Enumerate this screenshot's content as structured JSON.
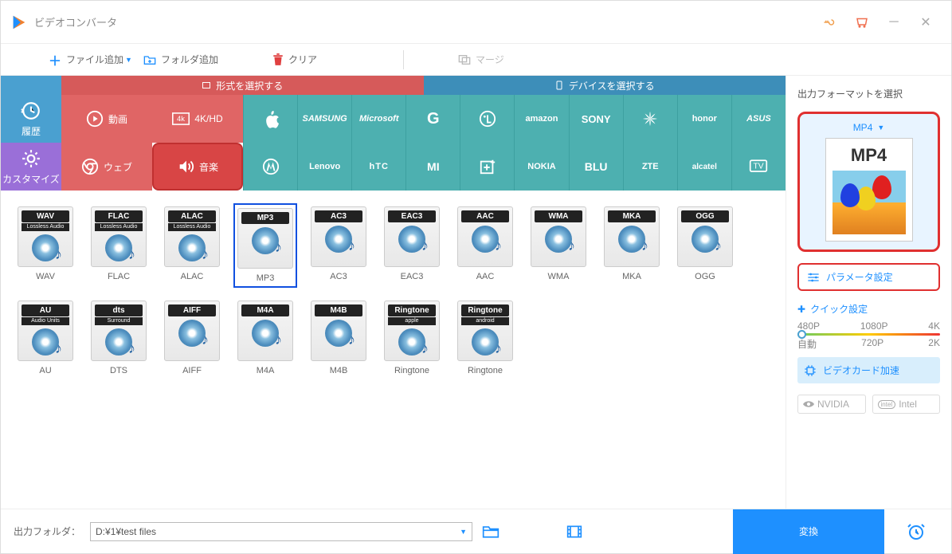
{
  "app": {
    "title": "ビデオコンバータ"
  },
  "toolbar": {
    "addFile": "ファイル追加",
    "addFolder": "フォルダ追加",
    "clear": "クリア",
    "merge": "マージ"
  },
  "tabs": {
    "format": "形式を選択する",
    "device": "デバイスを選択する"
  },
  "side": {
    "history": "履歴",
    "customize": "カスタマイズ"
  },
  "categories": {
    "video": "動画",
    "fourk": "4K/HD",
    "web": "ウェブ",
    "audio": "音楽"
  },
  "brands": [
    "Apple",
    "SAMSUNG",
    "Microsoft",
    "G",
    "LG",
    "amazon",
    "SONY",
    "HUAWEI",
    "honor",
    "ASUS",
    "Motorola",
    "Lenovo",
    "hTC",
    "MI",
    "OnePlus",
    "NOKIA",
    "BLU",
    "ZTE",
    "alcatel",
    "TV"
  ],
  "formats": [
    {
      "code": "WAV",
      "sub": "Lossless Audio",
      "label": "WAV"
    },
    {
      "code": "FLAC",
      "sub": "Lossless Audio",
      "label": "FLAC"
    },
    {
      "code": "ALAC",
      "sub": "Lossless Audio",
      "label": "ALAC"
    },
    {
      "code": "MP3",
      "sub": "",
      "label": "MP3",
      "selected": true
    },
    {
      "code": "AC3",
      "sub": "",
      "label": "AC3"
    },
    {
      "code": "EAC3",
      "sub": "",
      "label": "EAC3"
    },
    {
      "code": "AAC",
      "sub": "",
      "label": "AAC"
    },
    {
      "code": "WMA",
      "sub": "",
      "label": "WMA"
    },
    {
      "code": "MKA",
      "sub": "",
      "label": "MKA"
    },
    {
      "code": "OGG",
      "sub": "",
      "label": "OGG"
    },
    {
      "code": "AU",
      "sub": "Audio Units",
      "label": "AU"
    },
    {
      "code": "dts",
      "sub": "Surround",
      "label": "DTS"
    },
    {
      "code": "AIFF",
      "sub": "",
      "label": "AIFF"
    },
    {
      "code": "M4A",
      "sub": "",
      "label": "M4A"
    },
    {
      "code": "M4B",
      "sub": "",
      "label": "M4B"
    },
    {
      "code": "Ringtone",
      "sub": "apple",
      "label": "Ringtone"
    },
    {
      "code": "Ringtone",
      "sub": "android",
      "label": "Ringtone"
    }
  ],
  "rightPanel": {
    "title": "出力フォーマットを選択",
    "selected": "MP4",
    "badge": "MP4",
    "param": "パラメータ設定",
    "quick": "クイック設定",
    "res": {
      "p480": "480P",
      "p1080": "1080P",
      "k4": "4K",
      "auto": "自動",
      "p720": "720P",
      "k2": "2K"
    },
    "accel": "ビデオカード加速",
    "gpu": {
      "nvidia": "NVIDIA",
      "intel": "Intel"
    }
  },
  "footer": {
    "label": "出力フォルダ：",
    "path": "D:¥1¥test files",
    "convert": "変換"
  }
}
